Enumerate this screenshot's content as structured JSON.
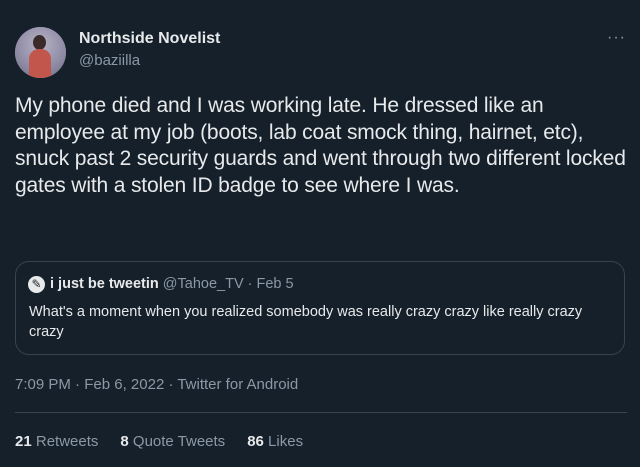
{
  "author": {
    "display_name": "Northside Novelist",
    "handle": "@baziilla"
  },
  "more_icon": "···",
  "tweet_text": "My phone died and I was working late. He dressed like an employee at my job (boots, lab coat smock thing, hairnet, etc), snuck past 2 security guards and went through two different locked gates with a stolen ID badge to see where I was.",
  "quoted_tweet": {
    "avatar_icon": "✎",
    "display_name": "i just be tweetin",
    "handle": "@Tahoe_TV",
    "separator": " · ",
    "date": "Feb 5",
    "text": "What's a moment when you realized somebody was really crazy crazy like really crazy crazy"
  },
  "meta": {
    "time": "7:09 PM",
    "separator": " · ",
    "date": "Feb 6, 2022",
    "client": "Twitter for Android"
  },
  "stats": {
    "retweets_count": "21",
    "retweets_label": "Retweets",
    "quotes_count": "8",
    "quotes_label": "Quote Tweets",
    "likes_count": "86",
    "likes_label": "Likes"
  },
  "colors": {
    "background": "#15202b",
    "text_primary": "#e7e9ea",
    "text_secondary": "#8b98a5",
    "border": "#38444d"
  }
}
